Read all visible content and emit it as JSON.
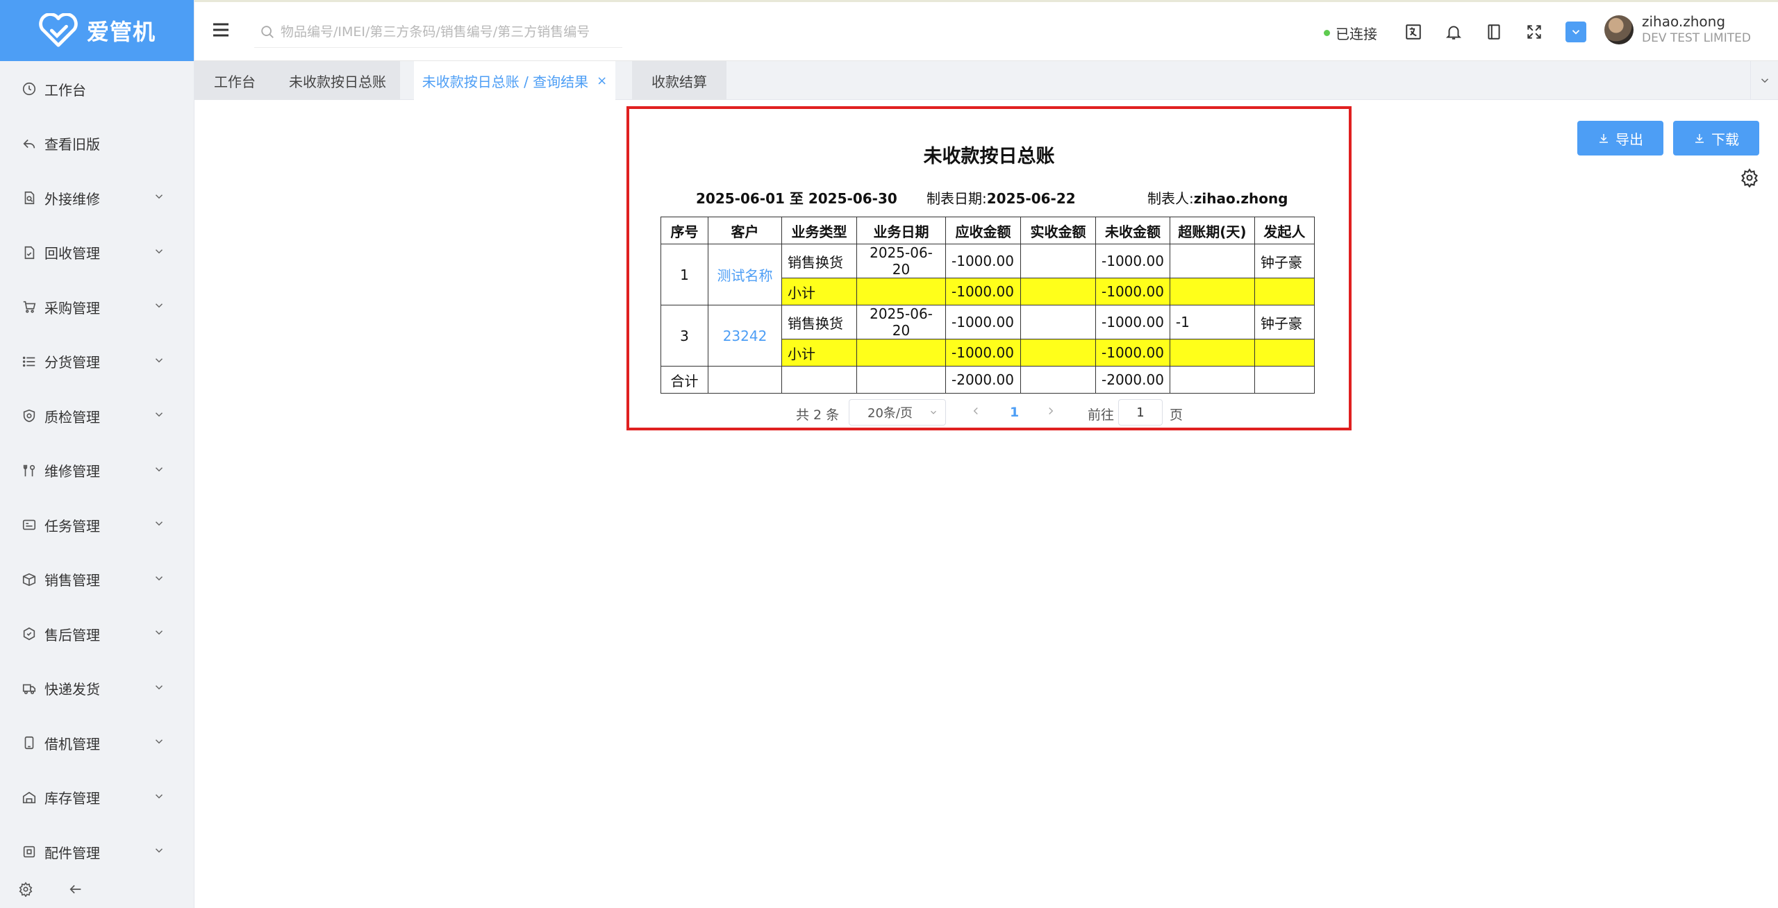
{
  "app": {
    "logo_text": "爱管机"
  },
  "sidebar": {
    "items": [
      {
        "label": "工作台",
        "icon": "clock-icon",
        "expandable": false
      },
      {
        "label": "查看旧版",
        "icon": "reply-icon",
        "expandable": false
      },
      {
        "label": "外接维修",
        "icon": "document-search-icon",
        "expandable": true
      },
      {
        "label": "回收管理",
        "icon": "recycle-doc-icon",
        "expandable": true
      },
      {
        "label": "采购管理",
        "icon": "cart-icon",
        "expandable": true
      },
      {
        "label": "分货管理",
        "icon": "list-icon",
        "expandable": true
      },
      {
        "label": "质检管理",
        "icon": "shield-check-icon",
        "expandable": true
      },
      {
        "label": "维修管理",
        "icon": "tools-icon",
        "expandable": true
      },
      {
        "label": "任务管理",
        "icon": "task-card-icon",
        "expandable": true
      },
      {
        "label": "销售管理",
        "icon": "box-icon",
        "expandable": true
      },
      {
        "label": "售后管理",
        "icon": "hexagon-icon",
        "expandable": true
      },
      {
        "label": "快递发货",
        "icon": "truck-icon",
        "expandable": true
      },
      {
        "label": "借机管理",
        "icon": "phone-icon",
        "expandable": true
      },
      {
        "label": "库存管理",
        "icon": "warehouse-icon",
        "expandable": true
      },
      {
        "label": "配件管理",
        "icon": "parts-icon",
        "expandable": true
      }
    ]
  },
  "header": {
    "search_placeholder": "物品编号/IMEI/第三方条码/销售编号/第三方销售编号",
    "connection_status": "已连接",
    "user_name": "zihao.zhong",
    "company": "DEV TEST LIMITED"
  },
  "tabs": [
    {
      "label": "工作台"
    },
    {
      "label": "未收款按日总账"
    },
    {
      "label": "未收款按日总账 / 查询结果",
      "active": true,
      "close": "×"
    },
    {
      "label": "收款结算"
    }
  ],
  "actions": {
    "export_label": "导出",
    "download_label": "下载"
  },
  "report": {
    "title": "未收款按日总账",
    "date_range": "2025-06-01 至 2025-06-30",
    "made_date_label": "制表日期:",
    "made_date": "2025-06-22",
    "maker_label": "制表人:",
    "maker": "zihao.zhong",
    "columns": [
      "序号",
      "客户",
      "业务类型",
      "业务日期",
      "应收金额",
      "实收金额",
      "未收金额",
      "超账期(天)",
      "发起人"
    ],
    "groups": [
      {
        "index": "1",
        "customer": "测试名称",
        "row": {
          "type": "销售换货",
          "date": "2025-06-20",
          "receivable": "-1000.00",
          "received": "",
          "unreceived": "-1000.00",
          "overdue": "",
          "initiator": "钟子豪"
        },
        "subtotal": {
          "label": "小计",
          "receivable": "-1000.00",
          "unreceived": "-1000.00"
        }
      },
      {
        "index": "3",
        "customer": "23242",
        "row": {
          "type": "销售换货",
          "date": "2025-06-20",
          "receivable": "-1000.00",
          "received": "",
          "unreceived": "-1000.00",
          "overdue": "-1",
          "initiator": "钟子豪"
        },
        "subtotal": {
          "label": "小计",
          "receivable": "-1000.00",
          "unreceived": "-1000.00"
        }
      }
    ],
    "total": {
      "label": "合计",
      "receivable": "-2000.00",
      "unreceived": "-2000.00"
    }
  },
  "pagination": {
    "total_text": "共 2 条",
    "page_size": "20条/页",
    "current_page": "1",
    "goto_label": "前往",
    "goto_value": "1",
    "page_suffix": "页"
  },
  "colors": {
    "accent": "#4d9ef5",
    "highlight": "#ffff1a",
    "report_border": "#e02020"
  }
}
